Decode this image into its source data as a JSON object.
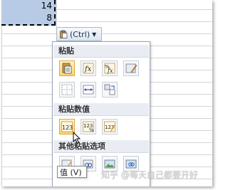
{
  "cells": {
    "row1": "14",
    "row2": "8"
  },
  "paste_options": {
    "button_label": "(Ctrl)",
    "sections": [
      {
        "title": "粘贴"
      },
      {
        "title": "粘贴数值"
      },
      {
        "title": "其他粘贴选项"
      }
    ],
    "icons_row1": [
      "paste-icon",
      "formula-icon",
      "formula-number-format-icon",
      "keep-source-formatting-icon"
    ],
    "icons_row2": [
      "no-borders-icon",
      "keep-column-widths-icon",
      "transpose-icon"
    ],
    "icons_row3": [
      "values-icon",
      "values-number-format-icon",
      "values-source-formatting-icon"
    ],
    "tooltip": "值 (V)"
  },
  "watermark": "知乎 @每天自己都要开好"
}
